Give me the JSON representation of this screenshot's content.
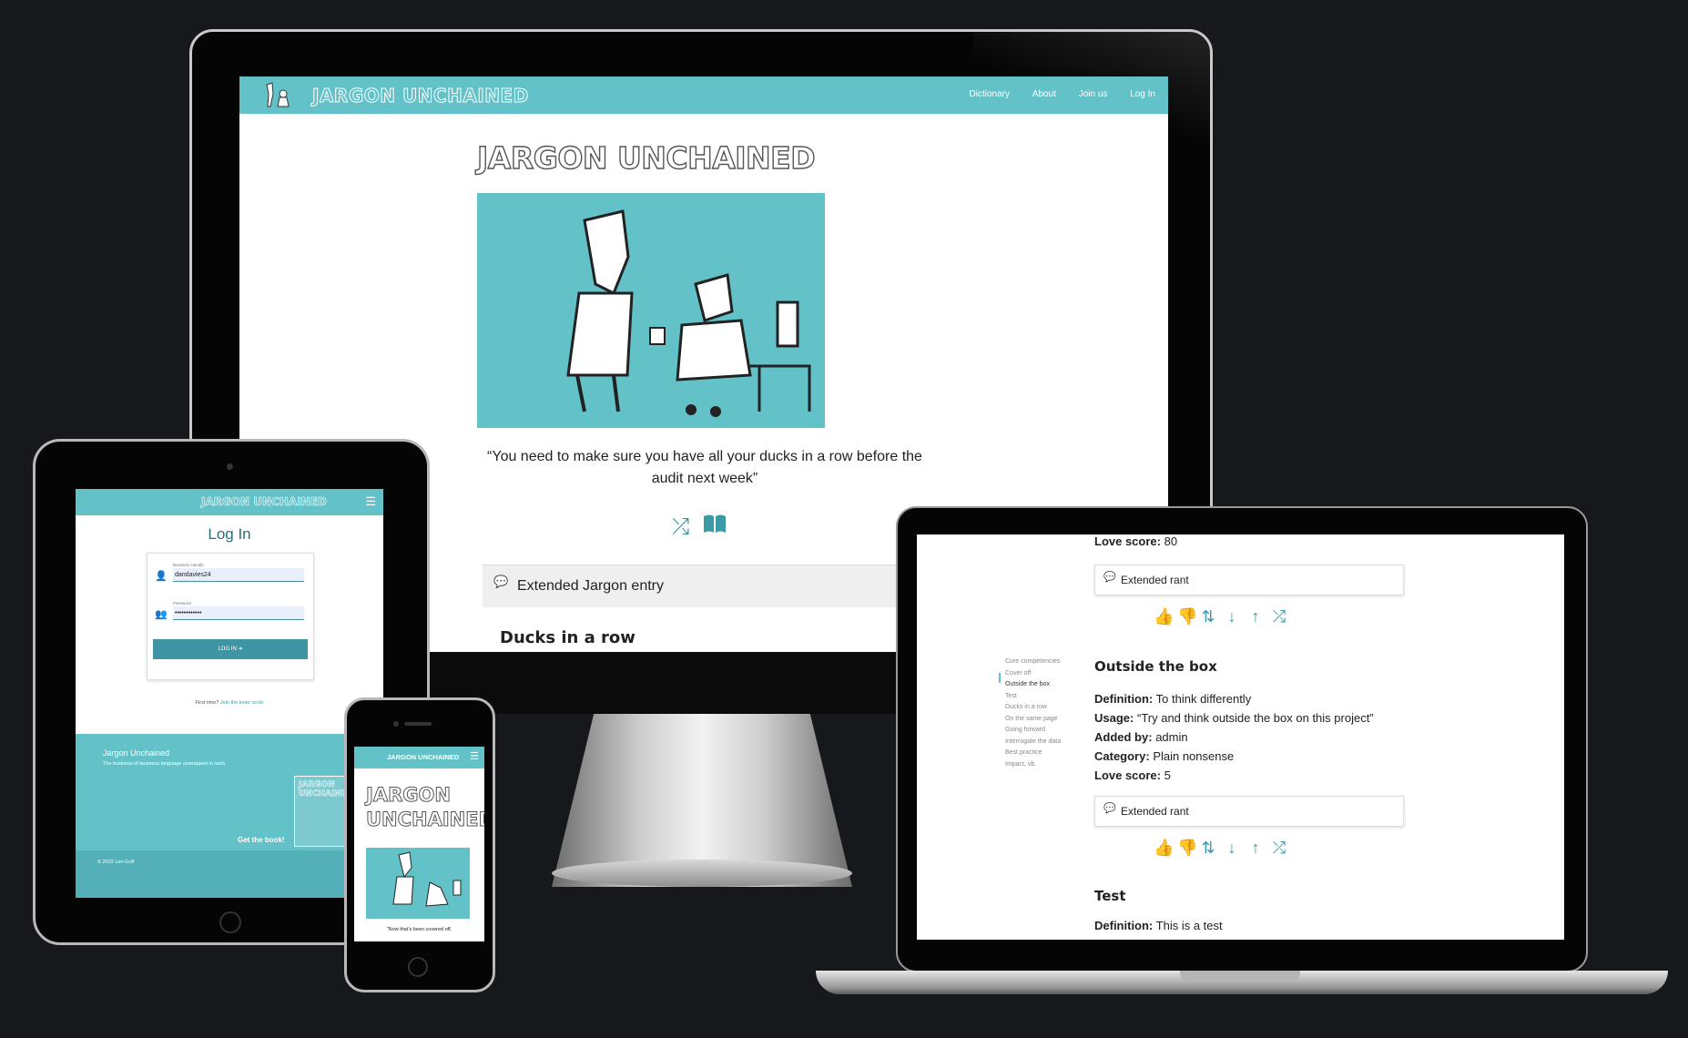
{
  "desktop": {
    "nav": {
      "brand": "JARGON UNCHAINED",
      "links": [
        "Dictionary",
        "About",
        "Join us",
        "Log In"
      ]
    },
    "title": "JARGON UNCHAINED",
    "quote": "“You need to make sure you have all your ducks in a row before the audit next week”",
    "icons": [
      "shuffle-icon",
      "book-open-icon"
    ],
    "card": {
      "header": "Extended Jargon entry",
      "subtitle": "Ducks in a row"
    }
  },
  "laptop": {
    "top_love": {
      "label": "Love score:",
      "value": "80"
    },
    "rant_label": "Extended rant",
    "vote_icons": [
      "thumbs-up-icon",
      "thumbs-down-icon",
      "sort-numeric-icon",
      "sort-alpha-down-icon",
      "sort-alpha-up-icon",
      "shuffle-icon"
    ],
    "sidebar": [
      "Core competencies",
      "Cover off",
      "Outside the box",
      "Test",
      "Ducks in a row",
      "On the same page",
      "Going forward",
      "Interrogate the data",
      "Best practice",
      "Impact, vb."
    ],
    "sidebar_active": "Outside the box",
    "entry": {
      "title": "Outside the box",
      "definition_label": "Definition:",
      "definition": "To think differently",
      "usage_label": "Usage:",
      "usage": "“Try and think outside the box on this project”",
      "added_by_label": "Added by:",
      "added_by": "admin",
      "category_label": "Category:",
      "category": "Plain nonsense",
      "love_label": "Love score:",
      "love": "5"
    },
    "next_entry": {
      "title": "Test",
      "definition_label": "Definition:",
      "definition": "This is a test"
    }
  },
  "tablet": {
    "brand": "JARGON UNCHAINED",
    "login_title": "Log In",
    "username_label": "Business Handle",
    "username_value": "dandavies24",
    "password_label": "Password",
    "password_value": "••••••••••••",
    "login_button": "LOG IN",
    "first_time": "First time?",
    "join_link": "Join the inner circle",
    "footer": {
      "name": "Jargon Unchained",
      "tagline": "The business of business language unwrapped in rants",
      "book_title": "JARGON UNCHAINED",
      "get_book": "Get the book!",
      "copyright": "© 2022 Len Goff"
    }
  },
  "phone": {
    "brand": "JARGON UNCHAINED",
    "title_line1": "JARGON",
    "title_line2": "UNCHAINED",
    "quote": "“Now that’s been covered off,"
  },
  "colors": {
    "accent": "#63c1c8",
    "icon": "#3a9aa6",
    "background": "#17181b"
  }
}
